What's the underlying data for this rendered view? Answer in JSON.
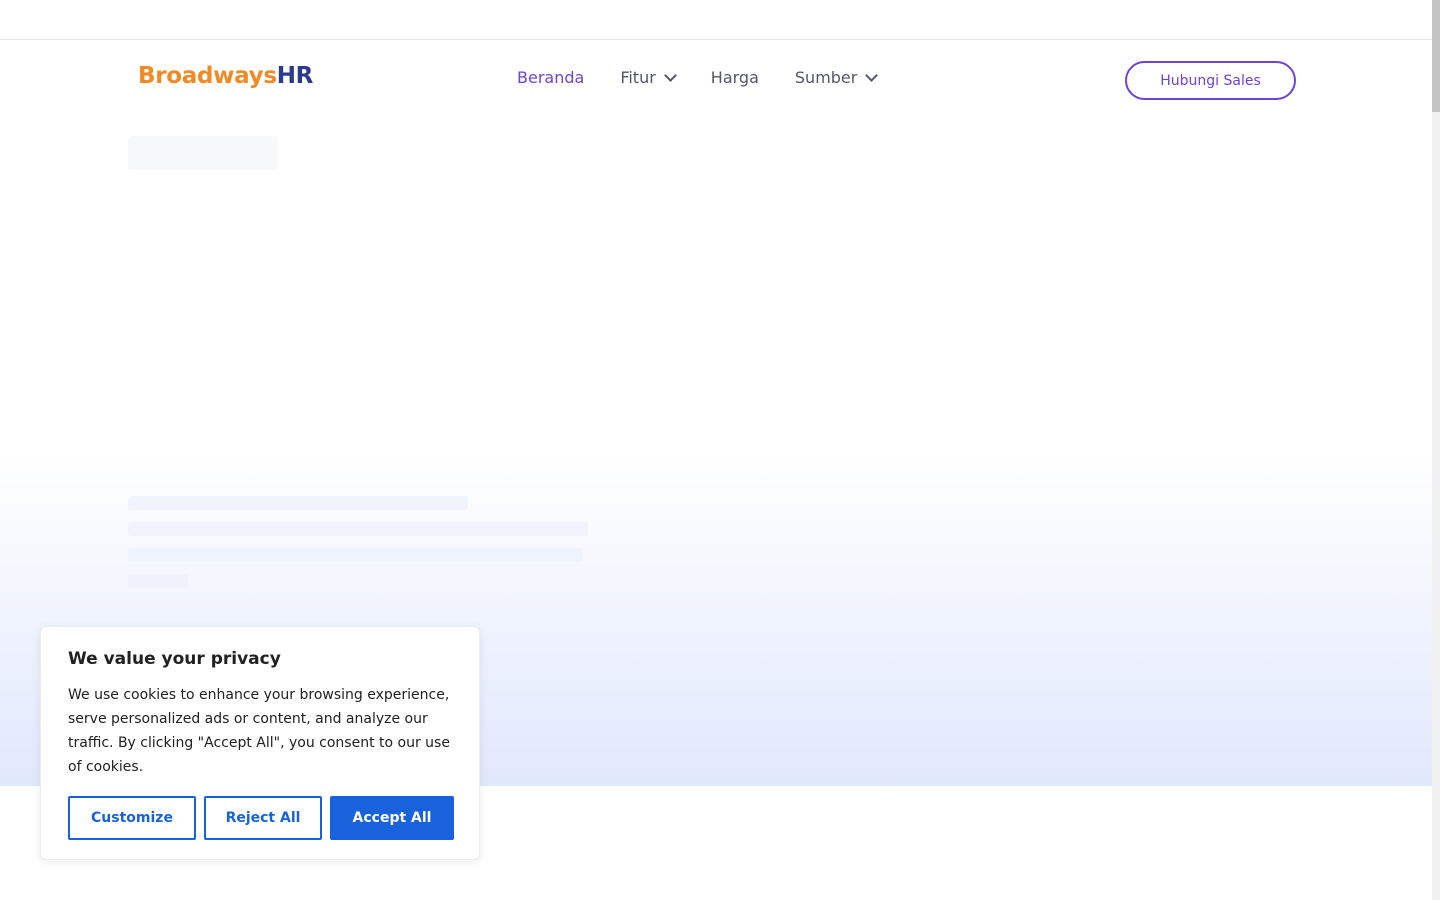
{
  "header": {
    "logo_part1": "Broadways",
    "logo_part2": "HR",
    "nav": [
      {
        "label": "Beranda"
      },
      {
        "label": "Fitur"
      },
      {
        "label": "Harga"
      },
      {
        "label": "Sumber"
      }
    ],
    "cta_label": "Hubungi Sales"
  },
  "cookie": {
    "title": "We value your privacy",
    "body": "We use cookies to enhance your browsing experience, serve personalized ads or content, and analyze our traffic. By clicking \"Accept All\", you consent to our use of cookies.",
    "customize_label": "Customize",
    "reject_label": "Reject All",
    "accept_label": "Accept All"
  },
  "colors": {
    "accent": "#6b45d6",
    "logo_orange": "#f08a24",
    "logo_navy": "#2b3a8c",
    "cookie_blue": "#1863dc"
  },
  "icons": {
    "dropdown": "chevron-down-icon"
  }
}
